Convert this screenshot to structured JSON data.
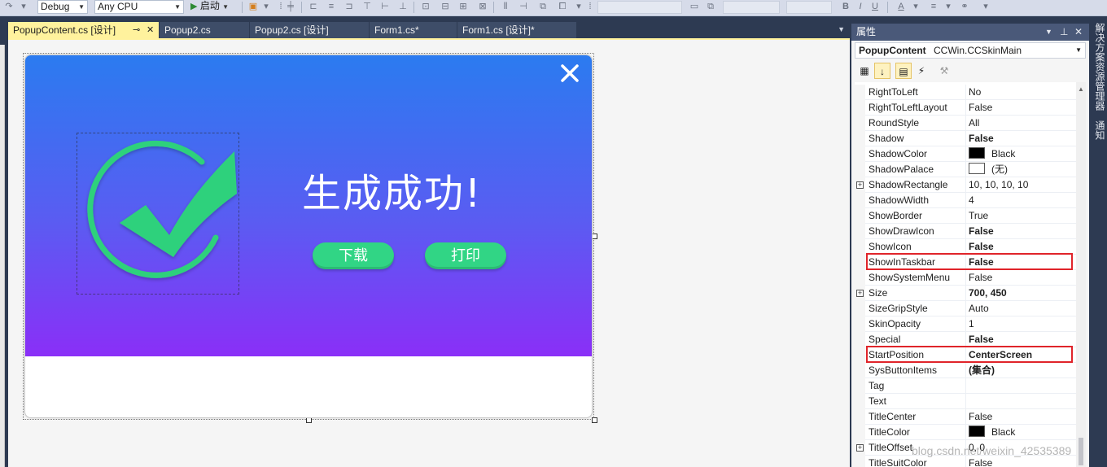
{
  "toolbar": {
    "config": "Debug",
    "platform": "Any CPU",
    "start_label": "启动"
  },
  "doc_tabs": [
    {
      "label": "PopupContent.cs [设计]",
      "active": true
    },
    {
      "label": "Popup2.cs",
      "active": false
    },
    {
      "label": "Popup2.cs [设计]",
      "active": false
    },
    {
      "label": "Form1.cs*",
      "active": false
    },
    {
      "label": "Form1.cs [设计]*",
      "active": false
    }
  ],
  "designer": {
    "popup": {
      "title": "生成成功!",
      "download_label": "下载",
      "print_label": "打印"
    }
  },
  "properties": {
    "title": "属性",
    "object_name": "PopupContent",
    "object_type": "CCWin.CCSkinMain",
    "rows": [
      {
        "name": "RightToLeft",
        "value": "No"
      },
      {
        "name": "RightToLeftLayout",
        "value": "False"
      },
      {
        "name": "RoundStyle",
        "value": "All"
      },
      {
        "name": "Shadow",
        "value": "False",
        "bold": true
      },
      {
        "name": "ShadowColor",
        "value": "Black",
        "swatch": "#000000"
      },
      {
        "name": "ShadowPalace",
        "value": "(无)",
        "swatch": "#ffffff"
      },
      {
        "name": "ShadowRectangle",
        "value": "10, 10, 10, 10",
        "expandable": true
      },
      {
        "name": "ShadowWidth",
        "value": "4"
      },
      {
        "name": "ShowBorder",
        "value": "True"
      },
      {
        "name": "ShowDrawIcon",
        "value": "False",
        "bold": true
      },
      {
        "name": "ShowIcon",
        "value": "False",
        "bold": true
      },
      {
        "name": "ShowInTaskbar",
        "value": "False",
        "bold": true,
        "highlight": true
      },
      {
        "name": "ShowSystemMenu",
        "value": "False"
      },
      {
        "name": "Size",
        "value": "700, 450",
        "bold": true,
        "expandable": true
      },
      {
        "name": "SizeGripStyle",
        "value": "Auto"
      },
      {
        "name": "SkinOpacity",
        "value": "1"
      },
      {
        "name": "Special",
        "value": "False",
        "bold": true
      },
      {
        "name": "StartPosition",
        "value": "CenterScreen",
        "bold": true,
        "highlight": true
      },
      {
        "name": "SysButtonItems",
        "value": "(集合)",
        "bold": true
      },
      {
        "name": "Tag",
        "value": ""
      },
      {
        "name": "Text",
        "value": ""
      },
      {
        "name": "TitleCenter",
        "value": "False"
      },
      {
        "name": "TitleColor",
        "value": "Black",
        "swatch": "#000000"
      },
      {
        "name": "TitleOffset",
        "value": "0, 0",
        "expandable": true
      },
      {
        "name": "TitleSuitColor",
        "value": "False"
      }
    ]
  },
  "right_rail": {
    "tab1": "解决方案资源管理器",
    "tab2": "通知"
  },
  "watermark": "blog.csdn.net/weixin_42535389",
  "colors": {
    "accent_tab": "#fff29d",
    "gradient_top": "#2b7bf0",
    "gradient_bottom": "#8a2ff7",
    "check_green": "#2fd17c",
    "highlight_red": "#e0242a"
  }
}
